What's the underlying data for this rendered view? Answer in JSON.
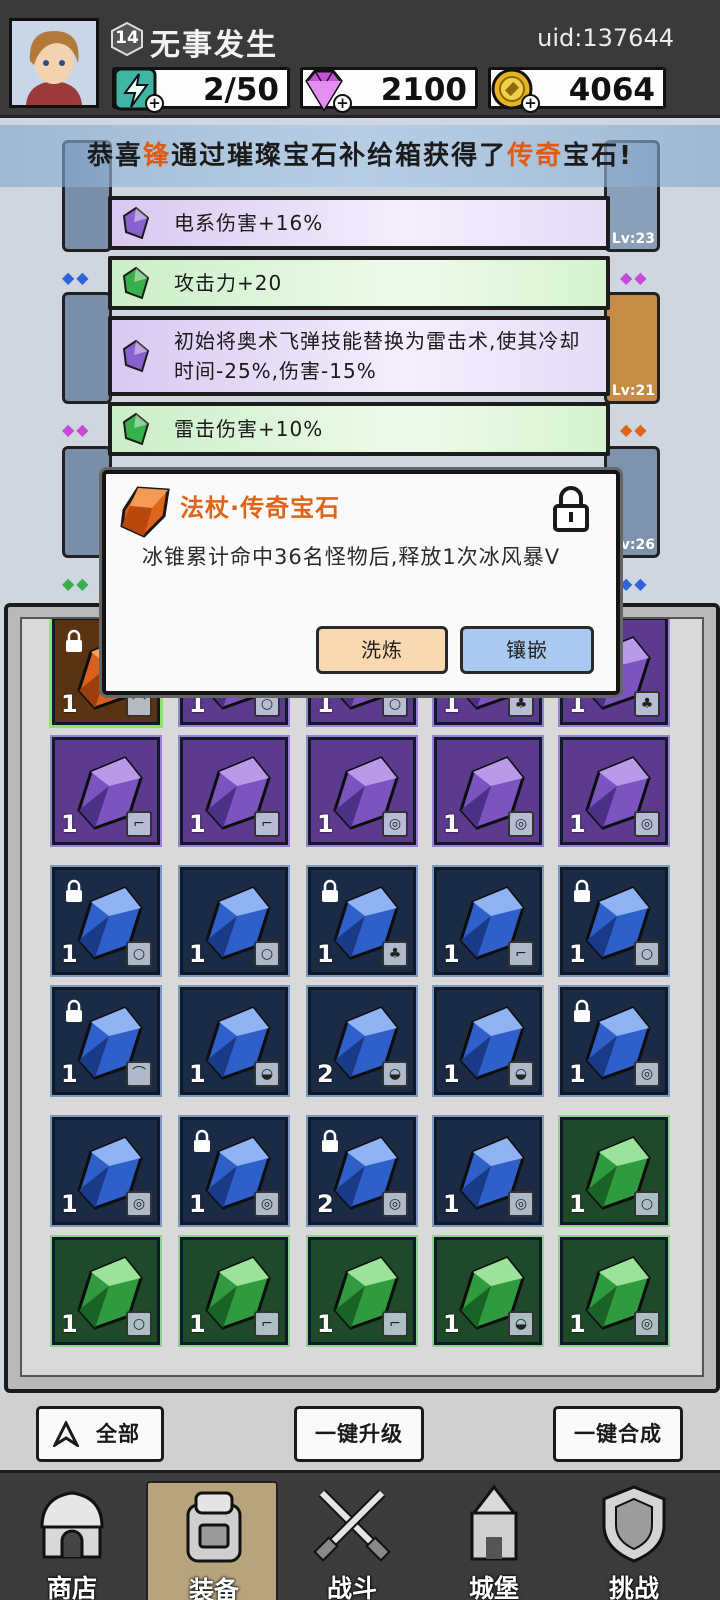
{
  "header": {
    "level": "14",
    "player_name": "无事发生",
    "uid": "uid:137644",
    "energy": "2/50",
    "gems": "2100",
    "coins": "4064"
  },
  "banner": {
    "part1": "恭喜",
    "player": "锋",
    "part2": "通过璀璨宝石补给箱获得了",
    "rarity": "传奇",
    "part3": "宝石!"
  },
  "equipment": {
    "slot1_level": "Lv:23",
    "slot2_level": "Lv:21",
    "slot3_level": "Lv:26"
  },
  "stats": [
    {
      "color": "purple",
      "text": "电系伤害+16%"
    },
    {
      "color": "green",
      "text": "攻击力+20"
    },
    {
      "color": "purple",
      "text": "初始将奥术飞弹技能替换为雷击术,使其冷却时间-25%,伤害-15%"
    },
    {
      "color": "green",
      "text": "雷击伤害+10%"
    }
  ],
  "popup": {
    "title": "法杖·传奇宝石",
    "description": "冰锥累计命中36名怪物后,释放1次冰风暴V",
    "refine_label": "洗炼",
    "inlay_label": "镶嵌"
  },
  "inventory": {
    "rows": [
      [
        {
          "color": "orange",
          "count": "1",
          "type": "wand",
          "locked": true
        },
        {
          "color": "purple",
          "count": "1",
          "type": "ring",
          "locked": false
        },
        {
          "color": "purple",
          "count": "1",
          "type": "ring",
          "locked": false
        },
        {
          "color": "purple",
          "count": "1",
          "type": "armor",
          "locked": false
        },
        {
          "color": "purple",
          "count": "1",
          "type": "armor",
          "locked": false
        }
      ],
      [
        {
          "color": "purple",
          "count": "1",
          "type": "boots",
          "locked": false
        },
        {
          "color": "purple",
          "count": "1",
          "type": "boots",
          "locked": false
        },
        {
          "color": "purple",
          "count": "1",
          "type": "necklace",
          "locked": false
        },
        {
          "color": "purple",
          "count": "1",
          "type": "necklace",
          "locked": false
        },
        {
          "color": "purple",
          "count": "1",
          "type": "necklace",
          "locked": false
        }
      ],
      [
        {
          "color": "blue",
          "count": "1",
          "type": "ring",
          "locked": true
        },
        {
          "color": "blue",
          "count": "1",
          "type": "ring",
          "locked": false
        },
        {
          "color": "blue",
          "count": "1",
          "type": "armor",
          "locked": true
        },
        {
          "color": "blue",
          "count": "1",
          "type": "boots",
          "locked": false
        },
        {
          "color": "blue",
          "count": "1",
          "type": "ring",
          "locked": true
        }
      ],
      [
        {
          "color": "blue",
          "count": "1",
          "type": "wand",
          "locked": true
        },
        {
          "color": "blue",
          "count": "1",
          "type": "helmet",
          "locked": false
        },
        {
          "color": "blue",
          "count": "2",
          "type": "helmet",
          "locked": false
        },
        {
          "color": "blue",
          "count": "1",
          "type": "helmet",
          "locked": false
        },
        {
          "color": "blue",
          "count": "1",
          "type": "necklace",
          "locked": true
        }
      ],
      [
        {
          "color": "blue",
          "count": "1",
          "type": "necklace",
          "locked": false
        },
        {
          "color": "blue",
          "count": "1",
          "type": "necklace",
          "locked": true
        },
        {
          "color": "blue",
          "count": "2",
          "type": "necklace",
          "locked": true
        },
        {
          "color": "blue",
          "count": "1",
          "type": "necklace",
          "locked": false
        },
        {
          "color": "green",
          "count": "1",
          "type": "ring",
          "locked": false
        }
      ],
      [
        {
          "color": "green",
          "count": "1",
          "type": "ring",
          "locked": false
        },
        {
          "color": "green",
          "count": "1",
          "type": "boots",
          "locked": false
        },
        {
          "color": "green",
          "count": "1",
          "type": "boots",
          "locked": false
        },
        {
          "color": "green",
          "count": "1",
          "type": "helmet",
          "locked": false
        },
        {
          "color": "green",
          "count": "1",
          "type": "necklace",
          "locked": false
        }
      ]
    ]
  },
  "actions": {
    "filter_label": "全部",
    "upgrade_all_label": "一键升级",
    "merge_all_label": "一键合成"
  },
  "nav": [
    {
      "label": "商店",
      "icon": "shop-icon",
      "active": false
    },
    {
      "label": "装备",
      "icon": "backpack-icon",
      "active": true
    },
    {
      "label": "战斗",
      "icon": "crossed-swords-icon",
      "active": false
    },
    {
      "label": "城堡",
      "icon": "castle-icon",
      "active": false
    },
    {
      "label": "挑战",
      "icon": "shield-icon",
      "active": false
    }
  ],
  "colors": {
    "purple": "#8a5fd0",
    "blue": "#3f6fd6",
    "green": "#36b04a",
    "orange": "#e0641a"
  }
}
